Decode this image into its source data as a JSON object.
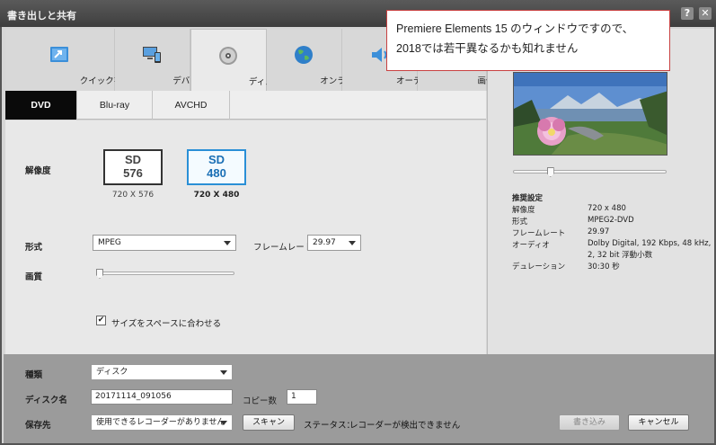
{
  "window": {
    "title": "書き出しと共有",
    "help_label": "?",
    "close_label": "✕"
  },
  "tabs": [
    {
      "label": "クイック書き出し",
      "icon": "quick-export-icon"
    },
    {
      "label": "デバイス",
      "icon": "devices-icon"
    },
    {
      "label": "ディスク",
      "icon": "disc-icon"
    },
    {
      "label": "オンライン",
      "icon": "globe-icon"
    },
    {
      "label": "オーディオ",
      "icon": "speaker-icon"
    },
    {
      "label": "画像",
      "icon": "image-icon"
    }
  ],
  "active_tab": "ディスク",
  "subtabs": [
    {
      "label": "DVD"
    },
    {
      "label": "Blu-ray"
    },
    {
      "label": "AVCHD"
    }
  ],
  "main": {
    "resolution_label": "解像度",
    "res_options": [
      {
        "sd": "SD",
        "num": "576",
        "caption": "720 X 576"
      },
      {
        "sd": "SD",
        "num": "480",
        "caption": "720 X 480"
      }
    ],
    "format_label": "形式",
    "format_value": "MPEG",
    "framerate_label": "フレームレート",
    "framerate_value": "29.97",
    "quality_label": "画質",
    "quality_level": 0,
    "fit_checkbox_label": "サイズをスペースに合わせる",
    "fit_checked": true
  },
  "preview": {
    "scrub_position": 0.25,
    "settings_title": "推奨設定",
    "rows": [
      {
        "key": "解像度",
        "value": "720 x 480"
      },
      {
        "key": "形式",
        "value": "MPEG2-DVD"
      },
      {
        "key": "フレームレート",
        "value": "29.97"
      },
      {
        "key": "オーディオ",
        "value": "Dolby Digital, 192 Kbps, 48 kHz,"
      },
      {
        "key": "",
        "value": "2, 32 bit 浮動小数"
      },
      {
        "key": "デュレーション",
        "value": "30:30 秒"
      }
    ]
  },
  "bottom": {
    "type_label": "種類",
    "type_value": "ディスク",
    "disc_name_label": "ディスク名",
    "disc_name_value": "20171114_091056",
    "copies_label": "コピー数",
    "copies_value": "1",
    "save_to_label": "保存先",
    "save_to_value": "使用できるレコーダーがありません",
    "scan_button": "スキャン",
    "status_label": "ステータス：",
    "status_value": "レコーダーが検出できません",
    "write_button": "書き込み",
    "cancel_button": "キャンセル"
  },
  "annotation": {
    "line1": "Premiere Elements 15 のウィンドウですので、",
    "line2": "2018では若干異なるかも知れません"
  },
  "colors": {
    "accent": "#2a8fd6",
    "active_subtab": "#0a0a0a",
    "callout_border": "#c84242"
  }
}
